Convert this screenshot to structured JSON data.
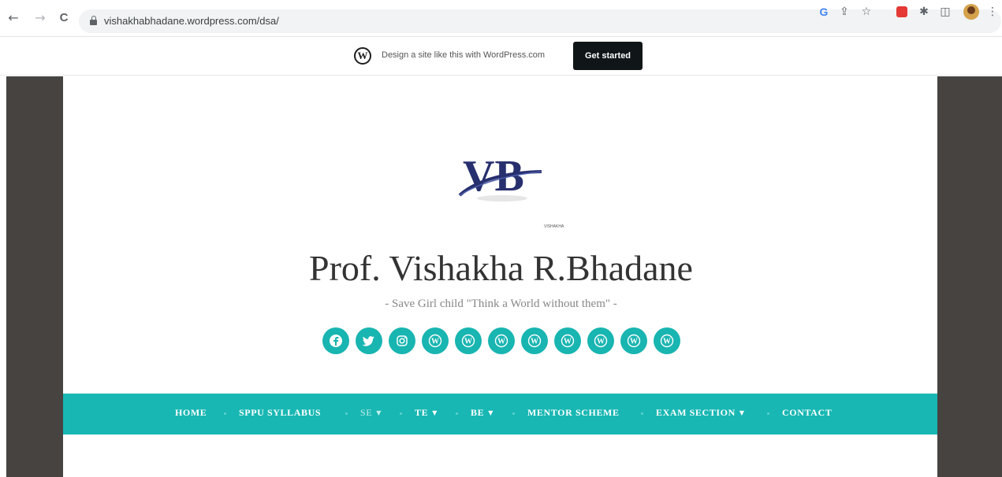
{
  "browser": {
    "url": "vishakhabhadane.wordpress.com/dsa/",
    "back_icon": "←",
    "forward_icon": "→",
    "reload_icon": "C",
    "toolbar_icons": [
      "google-icon",
      "share-icon",
      "star-icon",
      "extension-red-icon",
      "puzzle-icon",
      "sidepanel-icon",
      "profile-avatar",
      "menu-icon"
    ],
    "g_letter": "G",
    "share_glyph": "⇪",
    "star_glyph": "☆",
    "puzzle_glyph": "✱",
    "panel_glyph": "◫",
    "menu_glyph": "⋮"
  },
  "wp_banner": {
    "logo_letter": "W",
    "text": "Design a site like this with WordPress.com",
    "cta": "Get started"
  },
  "site": {
    "logo_text": "VB",
    "logo_caption": "VISHAKHA",
    "title": "Prof. Vishakha R.Bhadane",
    "tagline": "- Save Girl child \"Think a World without them\" -",
    "social_icons": [
      "facebook-icon",
      "twitter-icon",
      "instagram-icon",
      "wordpress-icon",
      "wordpress-icon",
      "wordpress-icon",
      "wordpress-icon",
      "wordpress-icon",
      "wordpress-icon",
      "wordpress-icon",
      "wordpress-icon"
    ]
  },
  "menu": {
    "items": [
      {
        "label": "HOME",
        "dropdown": false
      },
      {
        "label": "SPPU SYLLABUS",
        "dropdown": false
      },
      {
        "label": "SE",
        "dropdown": true
      },
      {
        "label": "TE",
        "dropdown": true
      },
      {
        "label": "BE",
        "dropdown": true
      },
      {
        "label": "MENTOR SCHEME",
        "dropdown": false
      },
      {
        "label": "EXAM SECTION",
        "dropdown": true
      },
      {
        "label": "CONTACT",
        "dropdown": false
      }
    ],
    "caret": "▼"
  },
  "colors": {
    "accent": "#18b7b3",
    "side_panel": "#464341",
    "logo_blue": "#27306e"
  }
}
